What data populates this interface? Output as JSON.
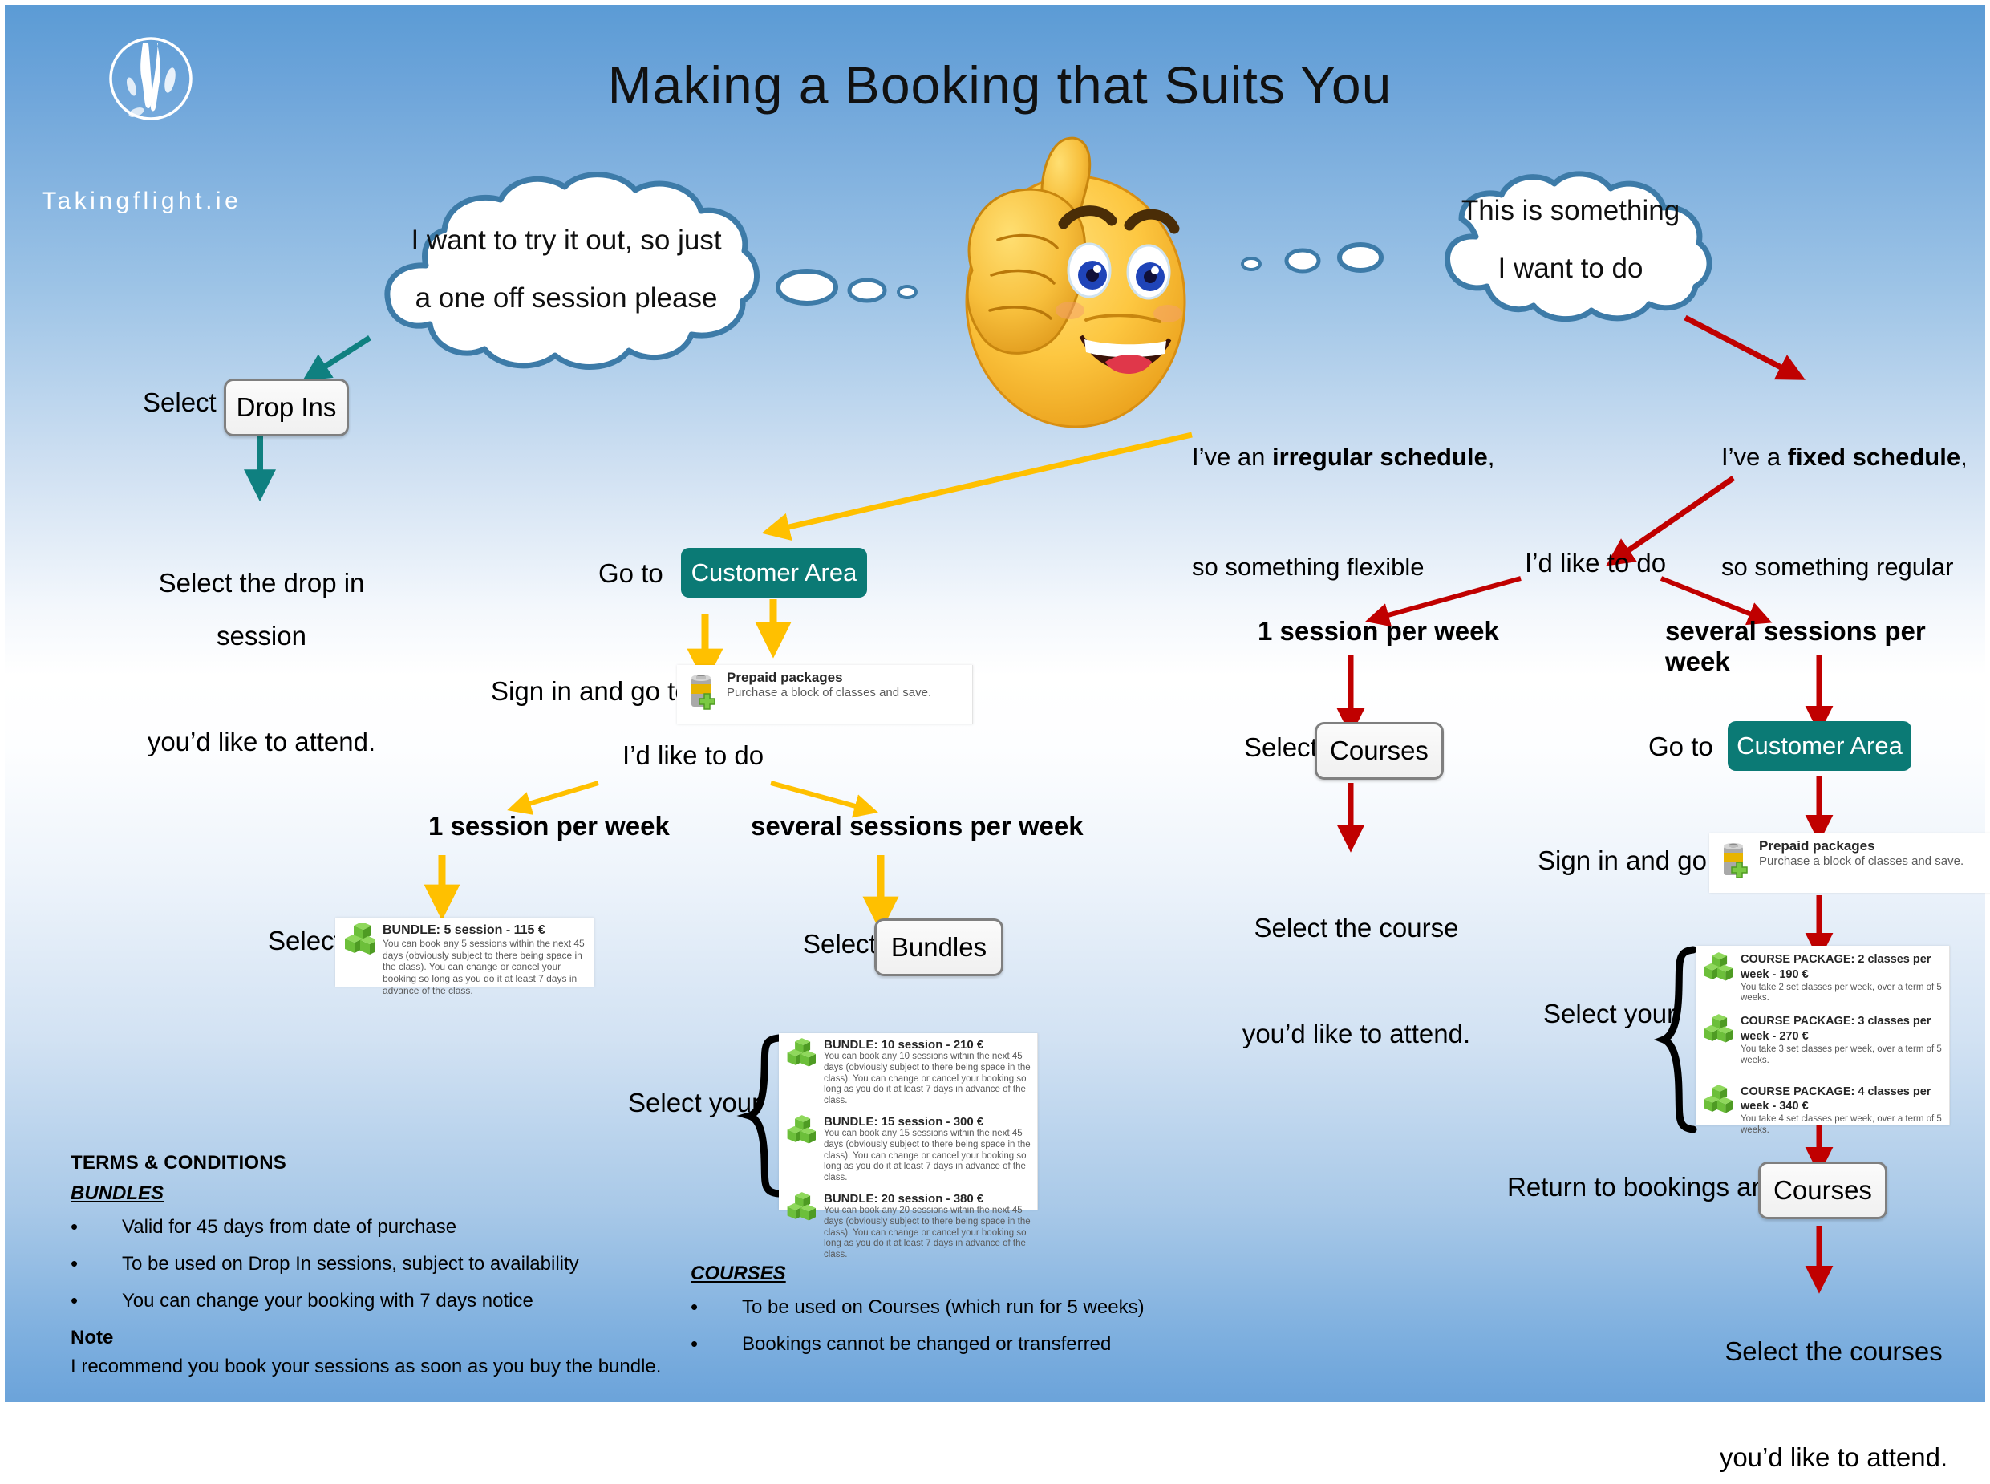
{
  "brand": {
    "logo_icon": "footprints-circle-logo",
    "name": "Takingflight.ie"
  },
  "header": {
    "title": "Making a Booking that Suits You"
  },
  "emoji": {
    "icon": "thumbs-up-smiley-emoji"
  },
  "bubbles": {
    "left": {
      "line1": "I want to try it out, so just",
      "line2": "a one off session please"
    },
    "right": {
      "line1": "This is something",
      "line2": "I want to do"
    }
  },
  "branch_dropin": {
    "select_label": "Select",
    "button": "Drop Ins",
    "result_line1": "Select the drop in session",
    "result_line2": "you’d like to attend."
  },
  "branch_irregular": {
    "intro_line1_pre": "I’ve an ",
    "intro_line1_bold": "irregular schedule",
    "intro_line1_post": ",",
    "intro_line2": "so something flexible",
    "goto_label": "Go to",
    "customer_area_button": "Customer Area",
    "signin_label": "Sign in and go to",
    "prepaid": {
      "icon": "battery-plus-icon",
      "title": "Prepaid packages",
      "desc": "Purchase a block of classes and save."
    },
    "idlike_label": "I’d like to do",
    "option_left": "1 session per week",
    "option_right": "several sessions per week",
    "select_label_left": "Select",
    "select_label_right": "Select",
    "bundles_button": "Bundles",
    "select_your_label": "Select your",
    "single_bundle": {
      "icon": "green-cubes-icon",
      "title": "BUNDLE: 5 session - 115 €",
      "desc": "You can book any 5 sessions within the next 45 days (obviously subject to there being space in the class). You can change or cancel your booking so long as you do it at least 7 days in advance of the class."
    },
    "bundle_list": [
      {
        "icon": "green-cubes-icon",
        "title": "BUNDLE: 10 session - 210 €",
        "desc": "You can book any 10 sessions within the next 45 days (obviously subject to there being space in the class). You can change or cancel your booking so long as you do it at least 7 days in advance of the class."
      },
      {
        "icon": "green-cubes-icon",
        "title": "BUNDLE: 15 session - 300 €",
        "desc": "You can book any 15 sessions within the next 45 days (obviously subject to there being space in the class). You can change or cancel your booking so long as you do it at least 7 days in advance of the class."
      },
      {
        "icon": "green-cubes-icon",
        "title": "BUNDLE: 20 session - 380 €",
        "desc": "You can book any 20 sessions within the next 45 days (obviously subject to there being space in the class). You can change or cancel your booking so long as you do it at least 7 days in advance of the class."
      }
    ]
  },
  "branch_fixed": {
    "intro_line1_pre": "I’ve a ",
    "intro_line1_bold": "fixed schedule",
    "intro_line1_post": ",",
    "intro_line2": "so something regular",
    "idlike_label": "I’d like to do",
    "option_left": "1 session per week",
    "option_right": "several sessions per week",
    "select_label": "Select",
    "courses_button": "Courses",
    "course_result_line1": "Select the course",
    "course_result_line2": "you’d like to attend.",
    "goto_label": "Go to",
    "customer_area_button": "Customer Area",
    "signin_label": "Sign in and go to",
    "prepaid": {
      "icon": "battery-plus-icon",
      "title": "Prepaid packages",
      "desc": "Purchase a block of classes and save."
    },
    "select_your_label": "Select your",
    "course_list": [
      {
        "icon": "green-cubes-icon",
        "title": "COURSE PACKAGE: 2 classes per week - 190 €",
        "desc": "You take 2 set classes per week, over a term of 5 weeks."
      },
      {
        "icon": "green-cubes-icon",
        "title": "COURSE PACKAGE: 3 classes per week - 270 €",
        "desc": "You take 3 set classes per week, over a term of 5 weeks."
      },
      {
        "icon": "green-cubes-icon",
        "title": "COURSE PACKAGE: 4 classes per week - 340 €",
        "desc": "You take 4 set classes per week, over a term of 5 weeks."
      }
    ],
    "return_label": "Return to bookings and select",
    "return_button": "Courses",
    "final_line1": "Select the courses",
    "final_line2": "you’d like to attend."
  },
  "terms": {
    "heading": "TERMS & CONDITIONS",
    "bundles_heading": "BUNDLES",
    "bundles_items": [
      "Valid for 45 days from date of purchase",
      "To be used on Drop In sessions, subject to availability",
      "You can change your booking with 7 days notice"
    ],
    "note_heading": "Note",
    "note_text": "I recommend you book your sessions as soon as you buy the bundle.",
    "courses_heading": "COURSES",
    "courses_items": [
      "To be used on Courses (which run for 5 weeks)",
      "Bookings cannot be changed or transferred"
    ]
  },
  "colors": {
    "teal_button": "#0b7a75",
    "teal_arrow": "#0f8080",
    "yellow_arrow": "#ffc000",
    "red_arrow": "#c00000",
    "cloud_outline": "#3d7ba8",
    "background_blue": "#5b9bd5"
  }
}
